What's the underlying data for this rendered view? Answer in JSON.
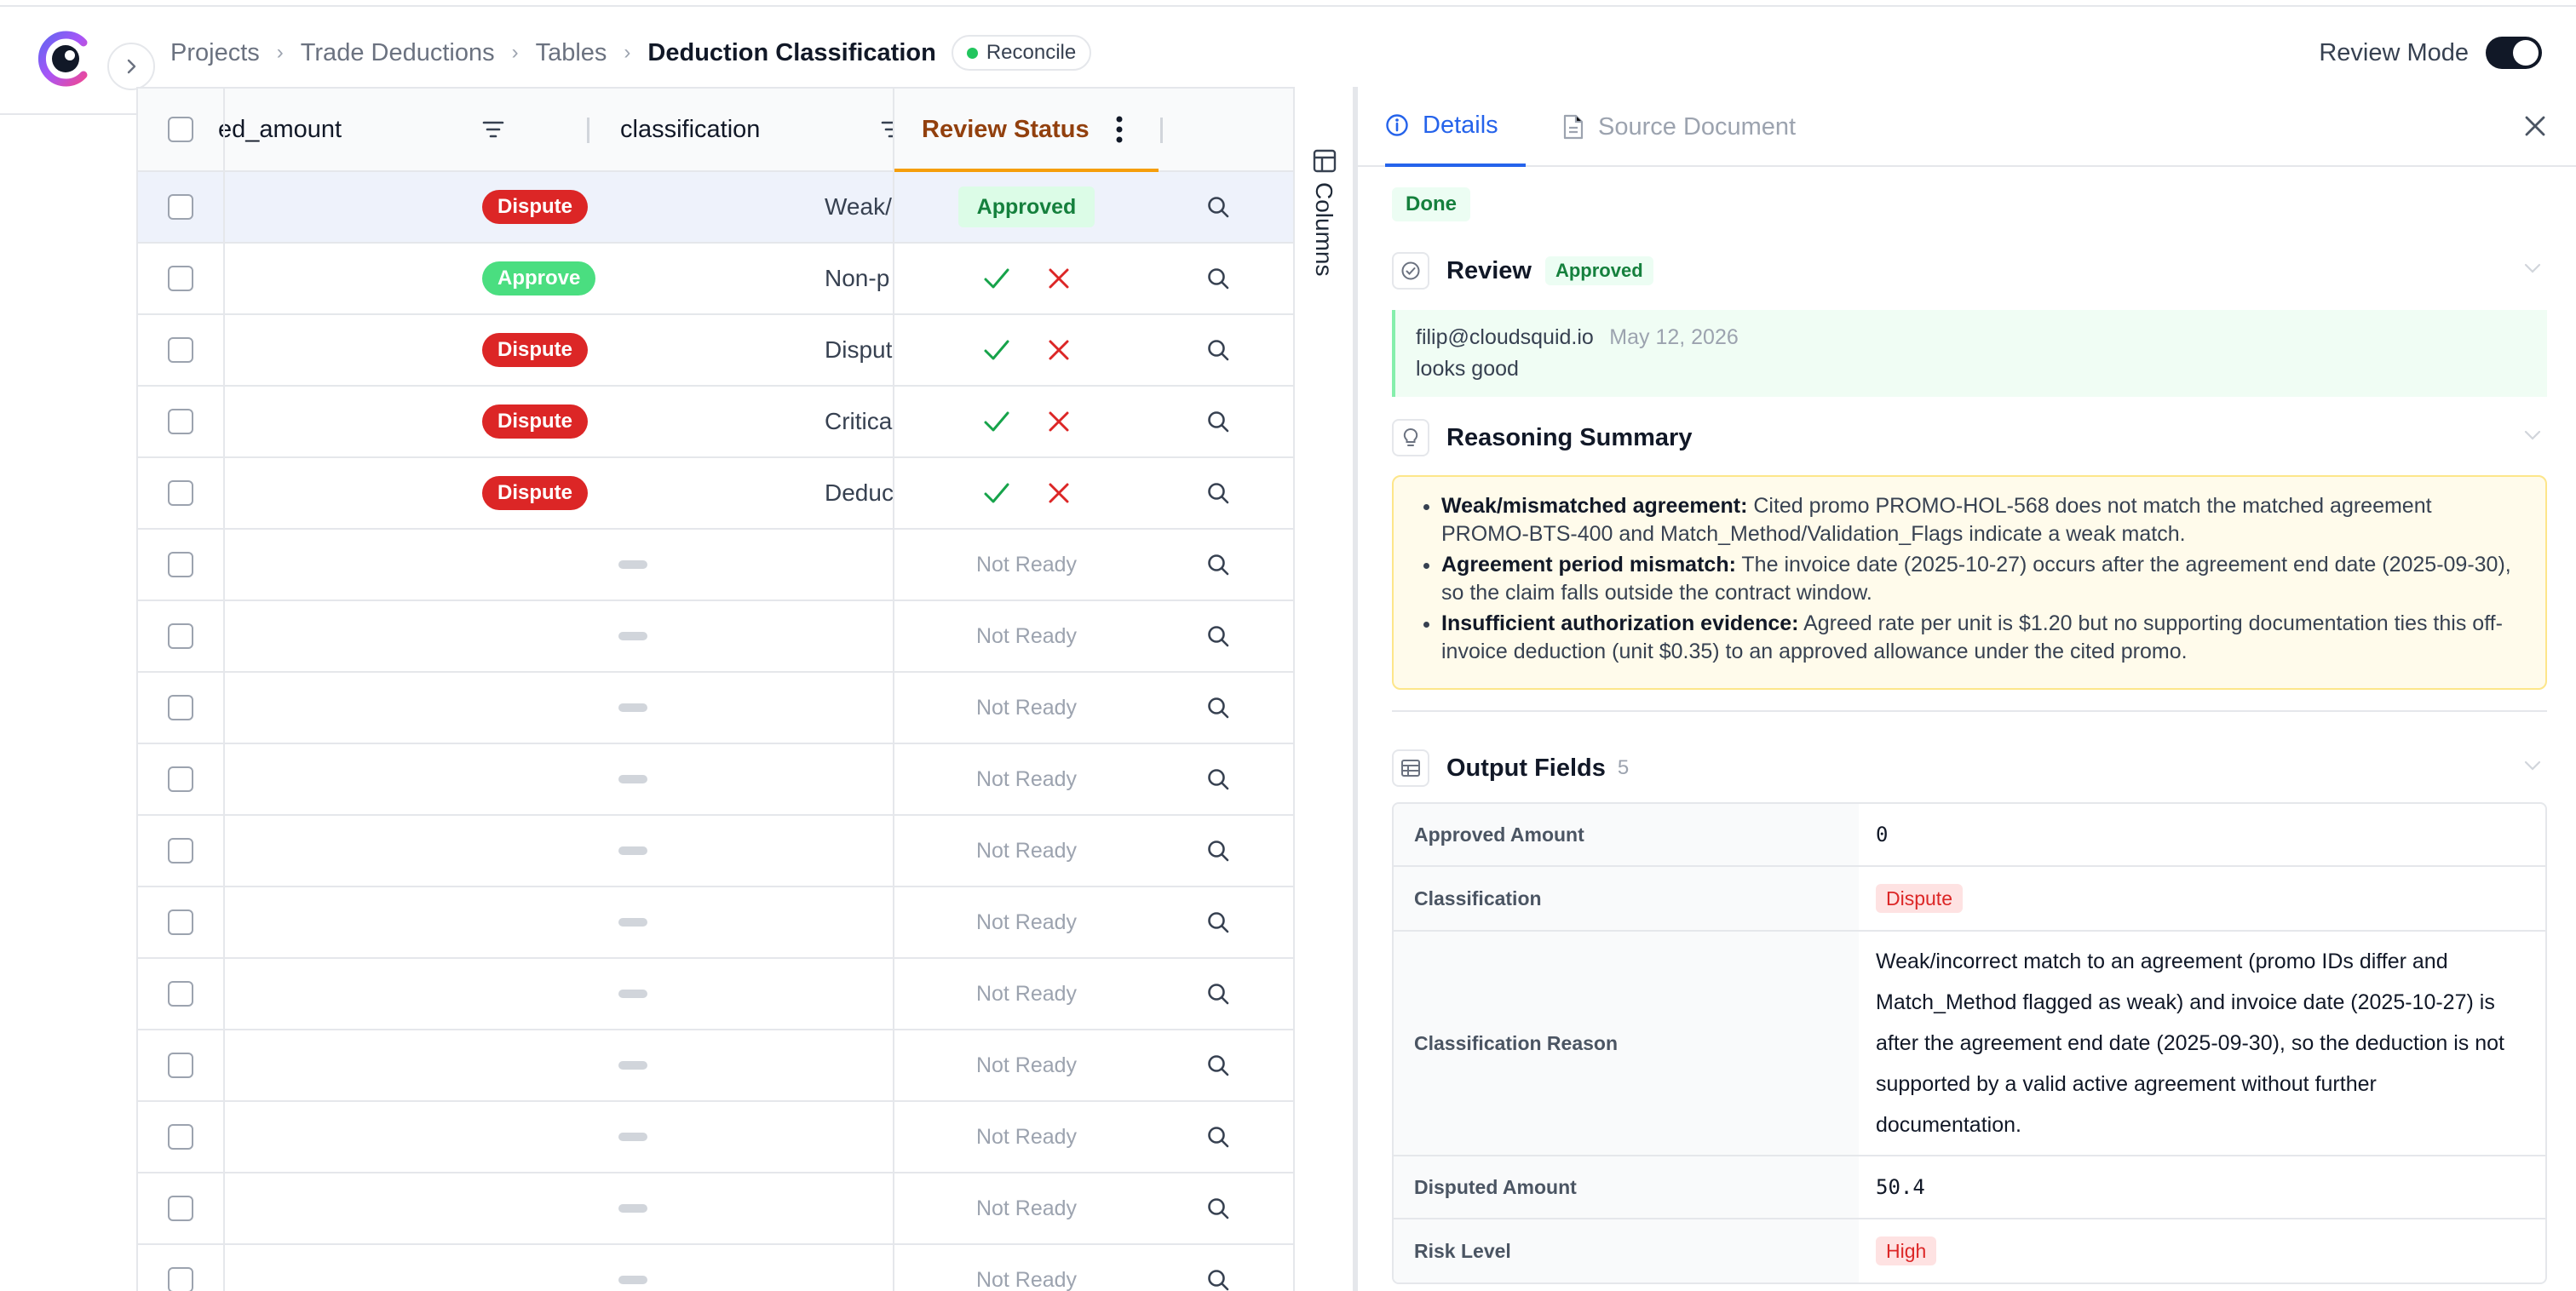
{
  "breadcrumb": {
    "items": [
      "Projects",
      "Trade Deductions",
      "Tables"
    ],
    "current": "Deduction Classification",
    "status_badge": "Reconcile"
  },
  "review_mode": {
    "label": "Review Mode",
    "enabled": true
  },
  "table": {
    "columns": [
      "ed_amount",
      "classification",
      "classif",
      "Review Status"
    ],
    "rows": [
      {
        "classification": "Dispute",
        "reason": "Weak/",
        "review": "Approved"
      },
      {
        "classification": "Approve",
        "reason": "Non-p",
        "review": "actions"
      },
      {
        "classification": "Dispute",
        "reason": "Disput",
        "review": "actions"
      },
      {
        "classification": "Dispute",
        "reason": "Critica",
        "review": "actions"
      },
      {
        "classification": "Dispute",
        "reason": "Deduc",
        "review": "actions"
      },
      {
        "classification": "",
        "reason": "",
        "review": "Not Ready"
      },
      {
        "classification": "",
        "reason": "",
        "review": "Not Ready"
      },
      {
        "classification": "",
        "reason": "",
        "review": "Not Ready"
      },
      {
        "classification": "",
        "reason": "",
        "review": "Not Ready"
      },
      {
        "classification": "",
        "reason": "",
        "review": "Not Ready"
      },
      {
        "classification": "",
        "reason": "",
        "review": "Not Ready"
      },
      {
        "classification": "",
        "reason": "",
        "review": "Not Ready"
      },
      {
        "classification": "",
        "reason": "",
        "review": "Not Ready"
      },
      {
        "classification": "",
        "reason": "",
        "review": "Not Ready"
      },
      {
        "classification": "",
        "reason": "",
        "review": "Not Ready"
      },
      {
        "classification": "",
        "reason": "",
        "review": "Not Ready"
      }
    ]
  },
  "columns_toggle": "Columns",
  "panel": {
    "tabs": [
      "Details",
      "Source Document"
    ],
    "status": "Done",
    "review": {
      "title": "Review",
      "badge": "Approved",
      "author": "filip@cloudsquid.io",
      "date": "May 12, 2026",
      "comment": "looks good"
    },
    "reasoning": {
      "title": "Reasoning Summary",
      "items": [
        {
          "head": "Weak/mismatched agreement:",
          "text": " Cited promo PROMO-HOL-568 does not match the matched agreement PROMO-BTS-400 and Match_Method/Validation_Flags indicate a weak match."
        },
        {
          "head": "Agreement period mismatch:",
          "text": " The invoice date (2025-10-27) occurs after the agreement end date (2025-09-30), so the claim falls outside the contract window."
        },
        {
          "head": "Insufficient authorization evidence:",
          "text": " Agreed rate per unit is $1.20 but no supporting documentation ties this off-invoice deduction (unit $0.35) to an approved allowance under the cited promo."
        }
      ]
    },
    "output_fields": {
      "title": "Output Fields",
      "count": "5",
      "fields": [
        {
          "key": "Approved Amount",
          "value": "0"
        },
        {
          "key": "Classification",
          "value": "Dispute"
        },
        {
          "key": "Classification Reason",
          "value": "Weak/incorrect match to an agreement (promo IDs differ and Match_Method flagged as weak) and invoice date (2025-10-27) is after the agreement end date (2025-09-30), so the deduction is not supported by a valid active agreement without further documentation."
        },
        {
          "key": "Disputed Amount",
          "value": "50.4"
        },
        {
          "key": "Risk Level",
          "value": "High"
        }
      ]
    }
  },
  "colors": {
    "accent": "#2563eb",
    "dispute": "#dc2626",
    "approve": "#4ade80",
    "highlight": "#f59e0b"
  }
}
